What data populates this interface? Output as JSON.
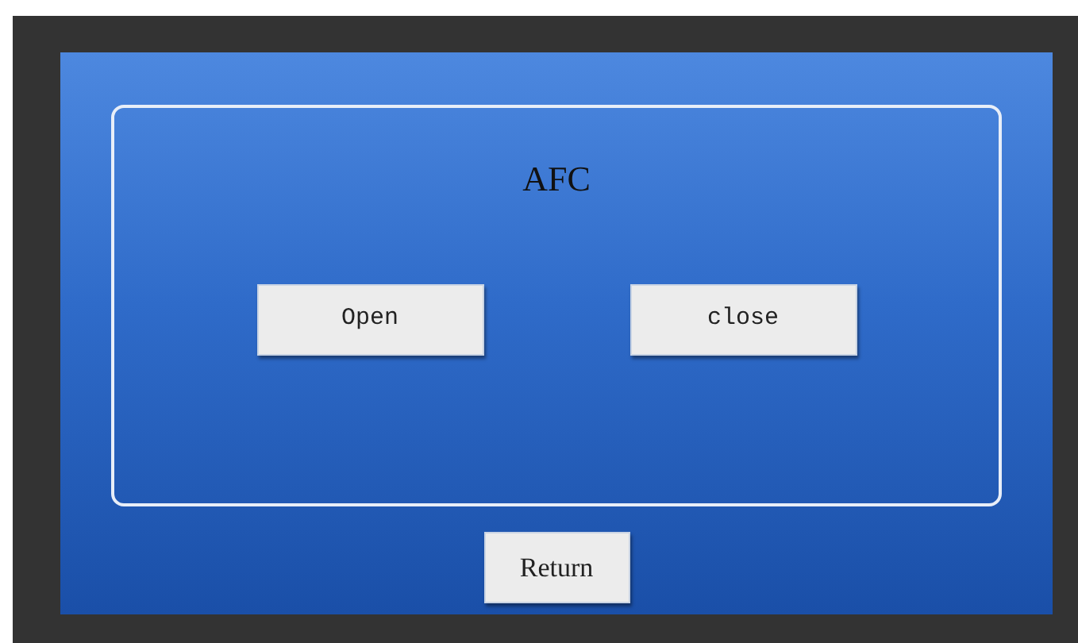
{
  "panel": {
    "title": "AFC",
    "buttons": [
      {
        "label": "Open"
      },
      {
        "label": "close"
      }
    ]
  },
  "return_button": {
    "label": "Return"
  }
}
